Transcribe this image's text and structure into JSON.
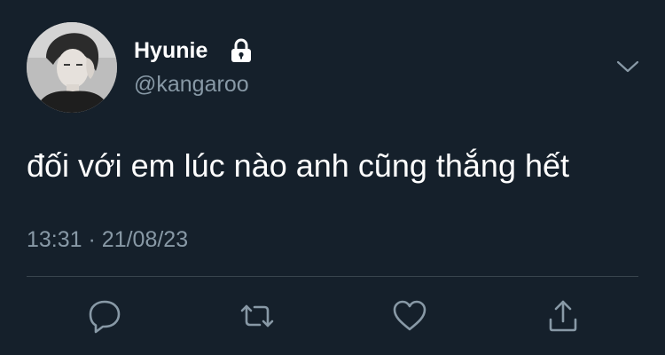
{
  "user": {
    "display_name": "Hyunie",
    "handle": "@kangaroo",
    "avatar_icon": "profile-photo",
    "lock_icon": "lock-icon"
  },
  "tweet": {
    "text": "đối với em lúc nào anh cũng thắng hết",
    "time": "13:31",
    "separator": "·",
    "date": "21/08/23"
  },
  "actions": {
    "reply_icon": "reply-icon",
    "retweet_icon": "retweet-icon",
    "like_icon": "heart-icon",
    "share_icon": "share-icon",
    "menu_icon": "chevron-down-icon"
  },
  "colors": {
    "background": "#15202b",
    "primary_text": "#ffffff",
    "secondary_text": "#8899a6",
    "divider": "#38444d"
  }
}
